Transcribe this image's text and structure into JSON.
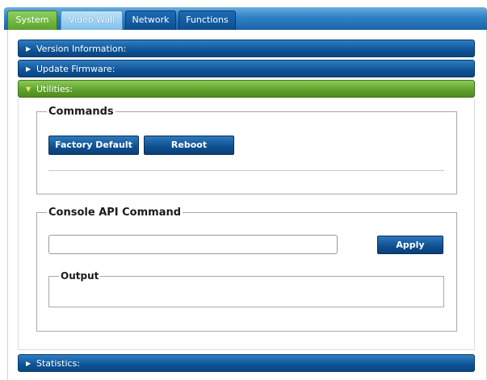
{
  "tabs": [
    {
      "label": "System",
      "active": true
    },
    {
      "label": "Video Wall",
      "active": false
    },
    {
      "label": "Network",
      "active": false
    },
    {
      "label": "Functions",
      "active": false
    }
  ],
  "sections": {
    "version": {
      "label": "Version Information:",
      "expanded": false
    },
    "firmware": {
      "label": "Update Firmware:",
      "expanded": false
    },
    "utilities": {
      "label": "Utilities:",
      "expanded": true
    },
    "statistics": {
      "label": "Statistics:",
      "expanded": false
    }
  },
  "commands": {
    "legend": "Commands",
    "factory_default_label": "Factory Default",
    "reboot_label": "Reboot"
  },
  "console": {
    "legend": "Console API Command",
    "input_value": "",
    "apply_label": "Apply",
    "output_legend": "Output",
    "output_text": ""
  },
  "colors": {
    "active_tab": "#6aae3a",
    "header_blue": "#0f5396",
    "header_green": "#5d9f2a"
  },
  "icons": {
    "collapsed_arrow": "▶",
    "expanded_arrow": "▼"
  }
}
